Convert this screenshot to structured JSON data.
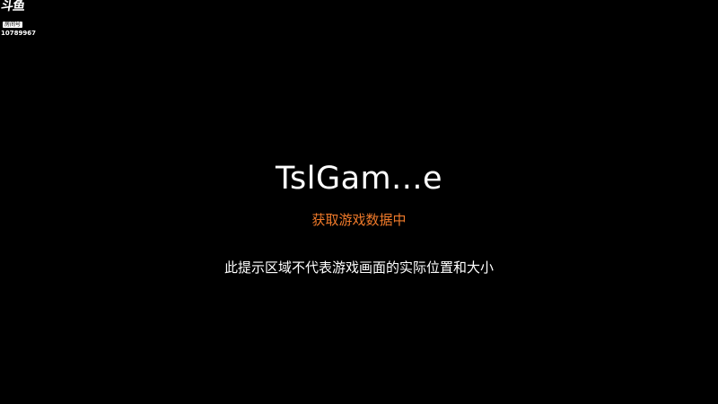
{
  "watermark": {
    "logo_text": "斗鱼",
    "tag": "房间号",
    "room_id": "10789967"
  },
  "loading": {
    "title": "TslGam...e",
    "status": "获取游戏数据中",
    "status_color": "#f07a2a",
    "notice": "此提示区域不代表游戏画面的实际位置和大小"
  },
  "colors": {
    "background": "#000000",
    "text": "#ffffff"
  }
}
